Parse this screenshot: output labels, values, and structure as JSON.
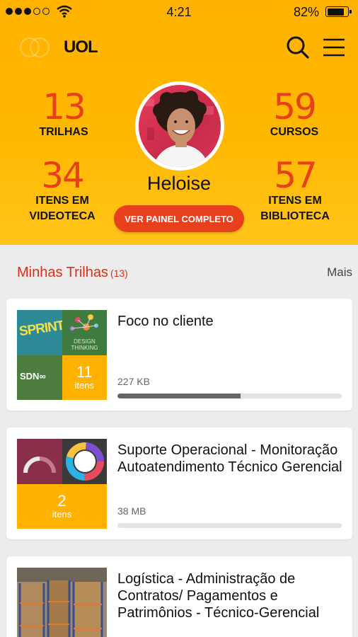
{
  "status": {
    "time": "4:21",
    "battery": "82%",
    "battery_level": 0.82
  },
  "brand": {
    "logo": "UOL"
  },
  "stats": {
    "trilhas": {
      "value": "13",
      "label": "TRILHAS"
    },
    "cursos": {
      "value": "59",
      "label": "CURSOS"
    },
    "videoteca": {
      "value": "34",
      "label1": "ITENS EM",
      "label2": "VIDEOTECA"
    },
    "biblioteca": {
      "value": "57",
      "label1": "ITENS EM",
      "label2": "BIBLIOTECA"
    }
  },
  "user": {
    "name": "Heloise"
  },
  "panel_button": "VER PAINEL COMPLETO",
  "section": {
    "title": "Minhas Trilhas",
    "count": "(13)",
    "more": "Mais"
  },
  "cards": [
    {
      "title": "Foco no cliente",
      "size": "227 KB",
      "progress": 0.55,
      "items_count": "11",
      "items_label": "itens",
      "thumb_labels": {
        "sprint": "SPRINT",
        "design": "DESIGN THINKING",
        "sdn": "SDN"
      }
    },
    {
      "title": "Suporte Operacional - Monitoração Autoatendimento Técnico Gerencial",
      "size": "38 MB",
      "progress": 0,
      "items_count": "2",
      "items_label": "itens"
    },
    {
      "title": "Logística - Administração de Contratos/ Pagamentos e Patrimônios - Técnico-Gerencial"
    }
  ],
  "colors": {
    "header": "#ffb300",
    "accent": "#e8401c",
    "item_tile": "#ffb300"
  }
}
